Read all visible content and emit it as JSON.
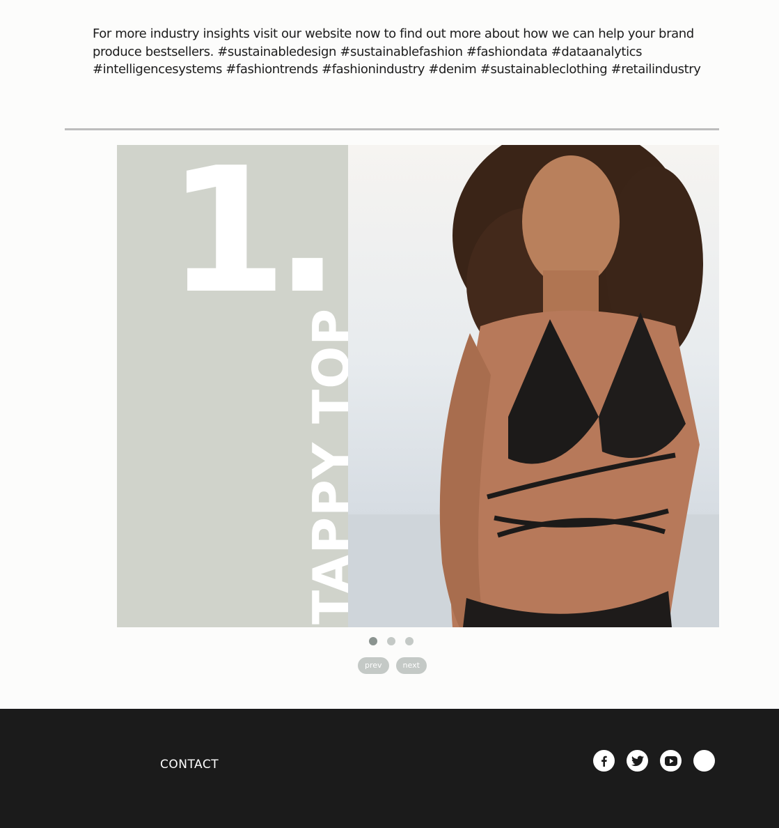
{
  "intro": {
    "text": "For more industry insights visit our website now to find out more about how we can help your brand produce bestsellers. #sustainabledesign #sustainablefashion #fashiondata #dataanalytics #intelligencesystems #fashiontrends #fashionindustry #denim #sustainableclothing #retailindustry"
  },
  "slider": {
    "slide": {
      "number": "1.",
      "label": "TAPPY TOP"
    },
    "current_slide": 1,
    "slide_count": 3,
    "prev_label": "prev",
    "next_label": "next"
  },
  "footer": {
    "contact_label": "CONTACT",
    "social_icons": [
      "facebook-icon",
      "twitter-icon",
      "youtube-icon",
      "social-icon"
    ]
  },
  "colors": {
    "footer_bg": "#1b1b1b",
    "panel_bg": "#d0d3cb",
    "dot_active": "#8b9490",
    "dot_inactive": "#c4c9c6"
  }
}
